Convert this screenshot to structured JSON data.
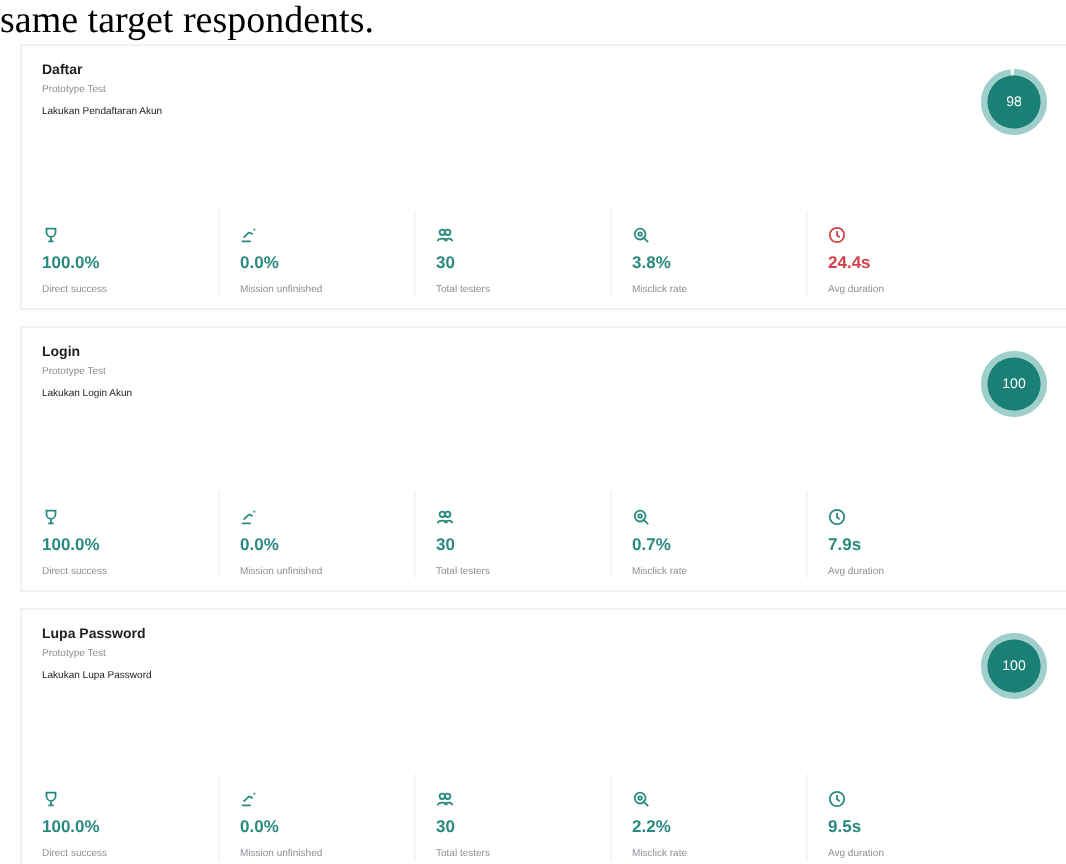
{
  "intro": "same target respondents.",
  "tasks": [
    {
      "title": "Daftar",
      "type": "Prototype Test",
      "description": "Lakukan Pendaftaran Akun",
      "score": "98",
      "level": 0.98,
      "metrics": [
        {
          "kind": "success",
          "value": "100.0%",
          "label": "Direct success",
          "alert": false
        },
        {
          "kind": "unfinished",
          "value": "0.0%",
          "label": "Mission unfinished",
          "alert": false
        },
        {
          "kind": "testers",
          "value": "30",
          "label": "Total testers",
          "alert": false
        },
        {
          "kind": "misclick",
          "value": "3.8%",
          "label": "Misclick rate",
          "alert": false
        },
        {
          "kind": "duration",
          "value": "24.4s",
          "label": "Avg duration",
          "alert": true
        }
      ]
    },
    {
      "title": "Login",
      "type": "Prototype Test",
      "description": "Lakukan Login Akun",
      "score": "100",
      "level": 1,
      "metrics": [
        {
          "kind": "success",
          "value": "100.0%",
          "label": "Direct success",
          "alert": false
        },
        {
          "kind": "unfinished",
          "value": "0.0%",
          "label": "Mission unfinished",
          "alert": false
        },
        {
          "kind": "testers",
          "value": "30",
          "label": "Total testers",
          "alert": false
        },
        {
          "kind": "misclick",
          "value": "0.7%",
          "label": "Misclick rate",
          "alert": false
        },
        {
          "kind": "duration",
          "value": "7.9s",
          "label": "Avg duration",
          "alert": false
        }
      ]
    },
    {
      "title": "Lupa Password",
      "type": "Prototype Test",
      "description": "Lakukan Lupa Password",
      "score": "100",
      "level": 1,
      "metrics": [
        {
          "kind": "success",
          "value": "100.0%",
          "label": "Direct success",
          "alert": false
        },
        {
          "kind": "unfinished",
          "value": "0.0%",
          "label": "Mission unfinished",
          "alert": false
        },
        {
          "kind": "testers",
          "value": "30",
          "label": "Total testers",
          "alert": false
        },
        {
          "kind": "misclick",
          "value": "2.2%",
          "label": "Misclick rate",
          "alert": false
        },
        {
          "kind": "duration",
          "value": "9.5s",
          "label": "Avg duration",
          "alert": false
        }
      ]
    }
  ]
}
